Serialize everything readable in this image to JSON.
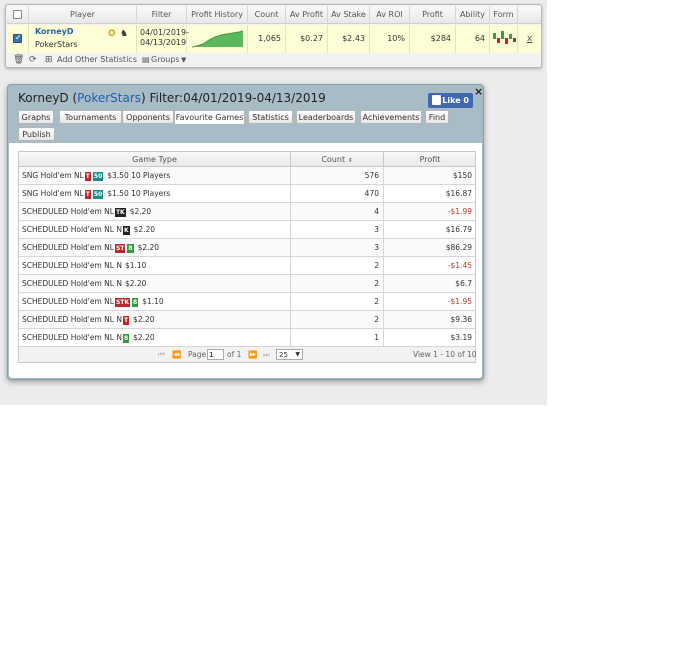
{
  "player_table": {
    "headers": [
      "Player",
      "Filter",
      "Profit History",
      "Count",
      "Av Profit",
      "Av Stake",
      "Av ROI",
      "Profit",
      "Ability",
      "Form"
    ],
    "row": {
      "name": "KorneyD",
      "site": "PokerStars",
      "filter_from": "04/01/2019-",
      "filter_to": "04/13/2019",
      "count": "1,065",
      "av_profit": "$0.27",
      "av_stake": "$2.43",
      "av_roi": "10%",
      "profit": "$284",
      "ability": "64",
      "remove": "x"
    },
    "toolbar": {
      "add_stats": "Add Other Statistics",
      "groups": "Groups"
    }
  },
  "dialog": {
    "title_player": "KorneyD (",
    "title_site": "PokerStars",
    "title_rest": ") Filter:04/01/2019-04/13/2019",
    "fb_like": "Like 0",
    "close": "×",
    "tabs": [
      "Graphs",
      "Tournaments",
      "Opponents",
      "Favourite Games",
      "Statistics",
      "Leaderboards",
      "Achievements",
      "Find",
      "Publish"
    ],
    "active_tab": "Favourite Games",
    "table": {
      "headers": [
        "Game Type",
        "Count",
        "Profit"
      ],
      "rows": [
        {
          "name": "SNG Hold'em NL",
          "badges": [
            "T",
            "50"
          ],
          "tail": "$3.50 10 Players",
          "count": "576",
          "profit": "$150"
        },
        {
          "name": "SNG Hold'em NL",
          "badges": [
            "T",
            "50"
          ],
          "tail": "$1.50 10 Players",
          "count": "470",
          "profit": "$16.87"
        },
        {
          "name": "SCHEDULED Hold'em NL",
          "badges": [
            "TK"
          ],
          "tail": "$2.20",
          "count": "4",
          "profit": "-$1.99"
        },
        {
          "name": "SCHEDULED Hold'em NL N",
          "badges": [
            "K"
          ],
          "tail": "$2.20",
          "count": "3",
          "profit": "$16.79"
        },
        {
          "name": "SCHEDULED Hold'em NL",
          "badges": [
            "ST",
            "8"
          ],
          "tail": "$2.20",
          "count": "3",
          "profit": "$86.29"
        },
        {
          "name": "SCHEDULED Hold'em NL N",
          "badges": [],
          "tail": "$1.10",
          "count": "2",
          "profit": "-$1.45"
        },
        {
          "name": "SCHEDULED Hold'em NL N",
          "badges": [],
          "tail": "$2.20",
          "count": "2",
          "profit": "$6.7"
        },
        {
          "name": "SCHEDULED Hold'em NL",
          "badges": [
            "STK",
            "8"
          ],
          "tail": "$1.10",
          "count": "2",
          "profit": "-$1.95"
        },
        {
          "name": "SCHEDULED Hold'em NL N",
          "badges": [
            "T"
          ],
          "tail": "$2.20",
          "count": "2",
          "profit": "$9.36"
        },
        {
          "name": "SCHEDULED Hold'em NL N",
          "badges": [
            "8"
          ],
          "tail": "$2.20",
          "count": "1",
          "profit": "$3.19"
        }
      ],
      "pager": {
        "page_label": "Page",
        "page_value": "1",
        "of_label": "of 1",
        "per_page": "25",
        "view": "View 1 - 10 of 10"
      }
    }
  },
  "colors": {
    "link": "#2463a6",
    "selected_row": "#fdfdd6",
    "dialog_frame": "#a8bcc8",
    "negative": "#c0392b",
    "facebook": "#4267b2"
  }
}
